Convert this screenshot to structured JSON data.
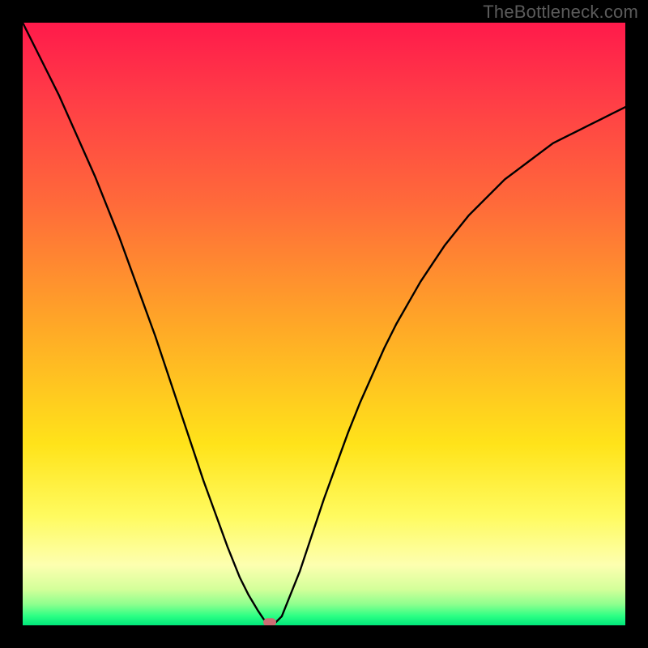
{
  "watermark": "TheBottleneck.com",
  "chart_data": {
    "type": "line",
    "title": "",
    "xlabel": "",
    "ylabel": "",
    "xlim": [
      0,
      100
    ],
    "ylim": [
      0,
      100
    ],
    "x": [
      0,
      2,
      4,
      6,
      8,
      10,
      12,
      14,
      16,
      18,
      20,
      22,
      24,
      26,
      28,
      30,
      32,
      34,
      36,
      37.5,
      39,
      40,
      41,
      42,
      43,
      44,
      46,
      48,
      50,
      52,
      54,
      56,
      58,
      60,
      62,
      64,
      66,
      68,
      70,
      72,
      74,
      76,
      78,
      80,
      82,
      84,
      86,
      88,
      90,
      92,
      94,
      96,
      98,
      100
    ],
    "values": [
      100,
      96,
      92,
      88,
      83.5,
      79,
      74.5,
      69.5,
      64.5,
      59,
      53.5,
      48,
      42,
      36,
      30,
      24,
      18.5,
      13,
      8,
      5,
      2.5,
      1,
      0.3,
      0.5,
      1.5,
      4,
      9,
      15,
      21,
      26.5,
      32,
      37,
      41.5,
      46,
      50,
      53.5,
      57,
      60,
      63,
      65.5,
      68,
      70,
      72,
      74,
      75.5,
      77,
      78.5,
      80,
      81,
      82,
      83,
      84,
      85,
      86
    ],
    "marker": {
      "x": 41,
      "y": 0.5
    },
    "gradient_stops": [
      {
        "offset": 0.0,
        "color": "#ff1a4b"
      },
      {
        "offset": 0.12,
        "color": "#ff3b47"
      },
      {
        "offset": 0.3,
        "color": "#ff6a3a"
      },
      {
        "offset": 0.5,
        "color": "#ffa727"
      },
      {
        "offset": 0.7,
        "color": "#ffe31a"
      },
      {
        "offset": 0.82,
        "color": "#fffb60"
      },
      {
        "offset": 0.9,
        "color": "#fdffb0"
      },
      {
        "offset": 0.94,
        "color": "#d4ff9a"
      },
      {
        "offset": 0.965,
        "color": "#8eff8e"
      },
      {
        "offset": 0.985,
        "color": "#2aff84"
      },
      {
        "offset": 1.0,
        "color": "#00e67a"
      }
    ],
    "curve_color": "#000000",
    "marker_color": "#cc6d74"
  }
}
